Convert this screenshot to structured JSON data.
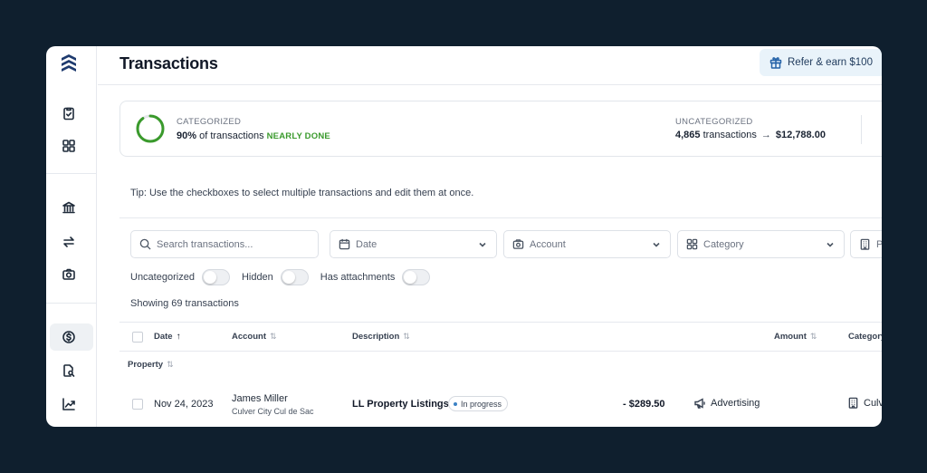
{
  "header": {
    "title": "Transactions",
    "refer_label": "Refer & earn $100"
  },
  "summary": {
    "categorized_label": "CATEGORIZED",
    "categorized_percent": "90%",
    "categorized_suffix": " of transactions",
    "categorized_progress": 0.9,
    "status_label": "NEARLY DONE",
    "uncategorized_label": "UNCATEGORIZED",
    "uncategorized_count": "4,865",
    "uncategorized_suffix": " transactions",
    "uncategorized_arrow": "→",
    "uncategorized_amount": "$12,788.00"
  },
  "tip": "Tip: Use the checkboxes to select multiple transactions and edit them at once.",
  "filters": {
    "search_placeholder": "Search transactions...",
    "date_label": "Date",
    "account_label": "Account",
    "category_label": "Category",
    "property_label": "Pr"
  },
  "toggles": [
    {
      "label": "Uncategorized",
      "on": false
    },
    {
      "label": "Hidden",
      "on": false
    },
    {
      "label": "Has attachments",
      "on": false
    }
  ],
  "showing_text": "Showing 69 transactions",
  "table": {
    "columns": {
      "date": "Date",
      "date_sort": "↑",
      "account": "Account",
      "description": "Description",
      "amount": "Amount",
      "category": "Category",
      "sort_glyph": "⇅"
    },
    "group_label": "Property",
    "rows": [
      {
        "date": "Nov 24, 2023",
        "account_name": "James Miller",
        "account_sub": "Culver City Cul de Sac",
        "description": "LL Property Listings",
        "status": "In progress",
        "amount": "- $289.50",
        "category": "Advertising",
        "property": "Culv"
      }
    ]
  },
  "colors": {
    "background": "#0f1f2e",
    "accent_green": "#3a9a2c",
    "refer_bg": "#e9f3fa"
  }
}
